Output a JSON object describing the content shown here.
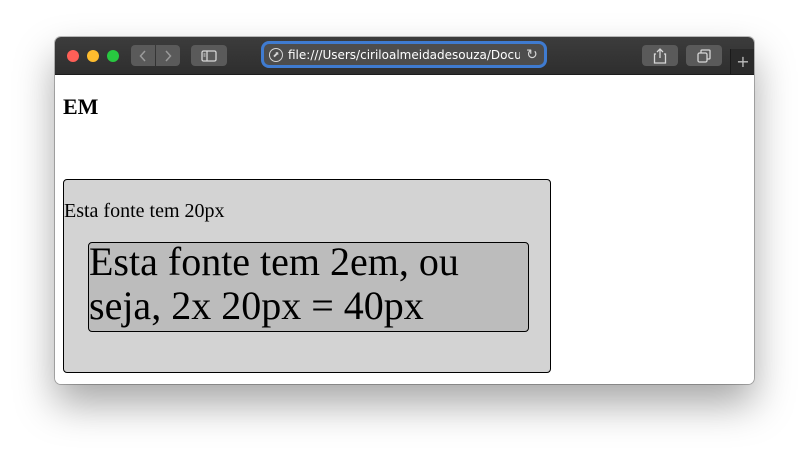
{
  "browser": {
    "url": "file:///Users/ciriloalmeidadesouza/Docum",
    "icons": {
      "back": "chevron-left-icon",
      "forward": "chevron-right-icon",
      "sidebar": "sidebar-icon",
      "share": "share-icon",
      "tabs": "tabs-overview-icon",
      "reload": "reload-icon",
      "new_tab": "plus-icon"
    },
    "accent_color": "#3f7bd0"
  },
  "page": {
    "heading": "EM",
    "outer_text": "Esta fonte tem 20px",
    "inner_text": "Esta fonte tem 2em, ou seja, 2x 20px = 40px",
    "colors": {
      "outer_background": "#d3d3d3",
      "inner_background": "#bcbcbc"
    }
  }
}
